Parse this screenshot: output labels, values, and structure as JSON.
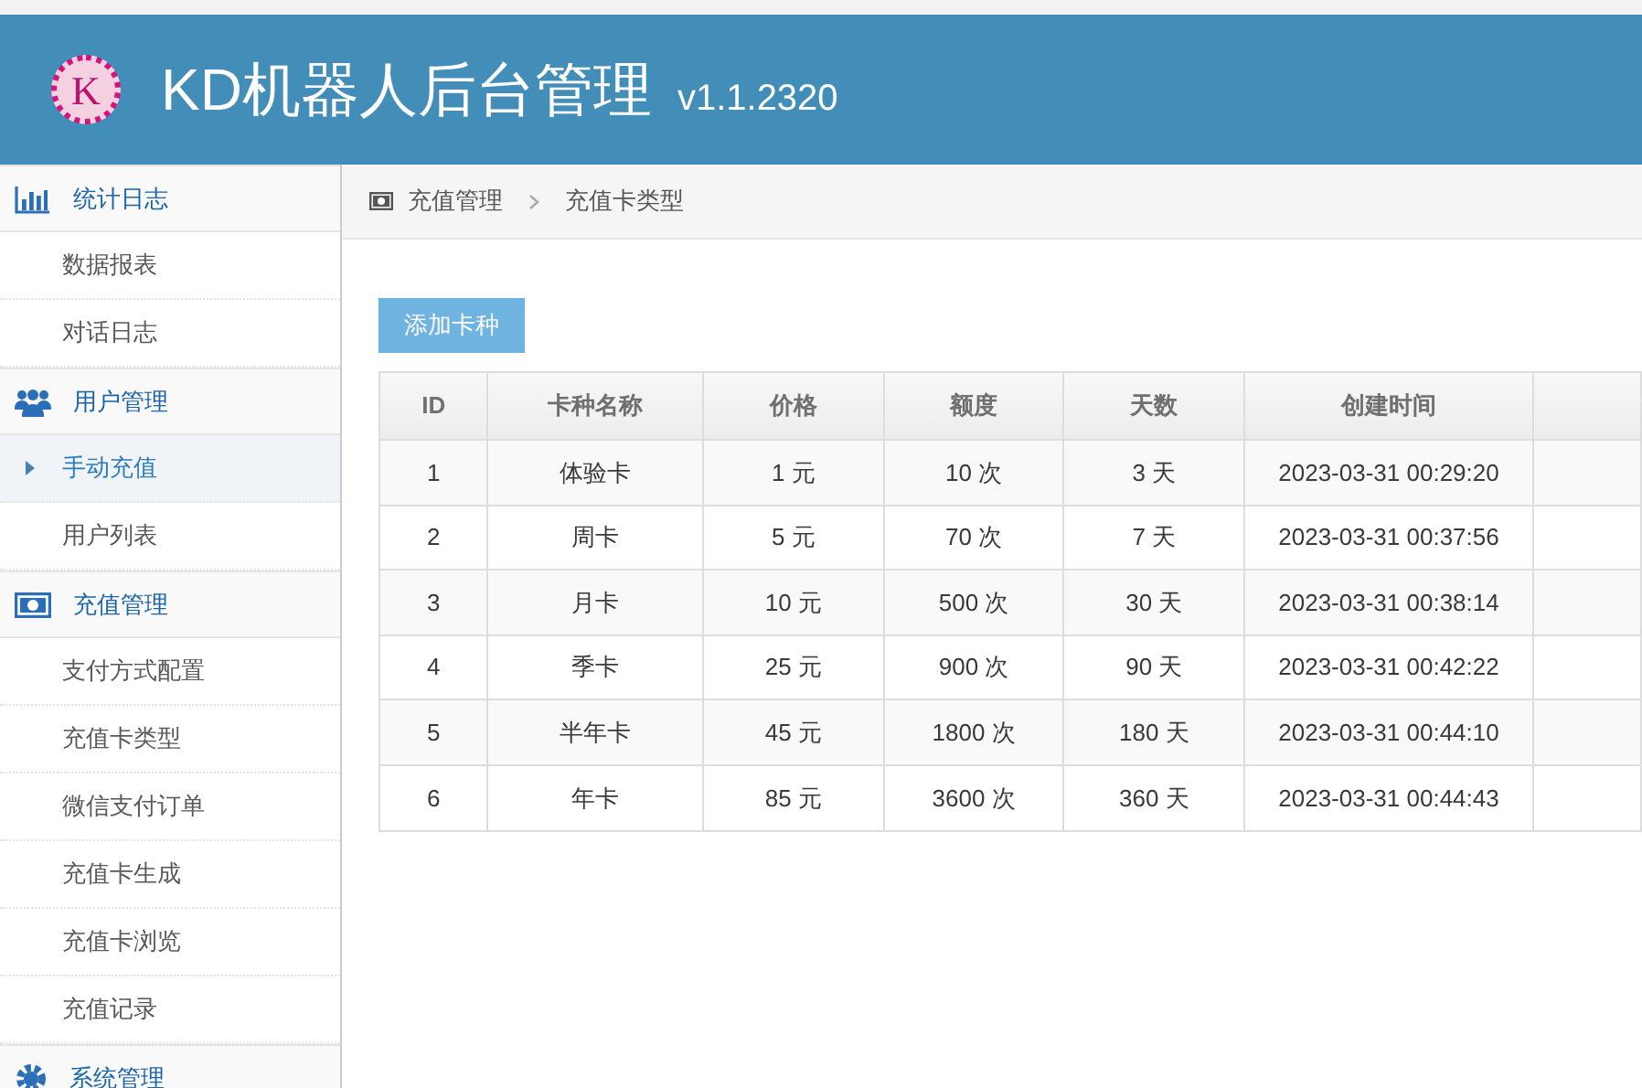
{
  "header": {
    "logo_letter": "K",
    "title": "KD机器人后台管理",
    "version": "v1.1.2320"
  },
  "sidebar": {
    "groups": [
      {
        "kind": "chart",
        "label": "统计日志",
        "items": [
          {
            "label": "数据报表",
            "selected": false
          },
          {
            "label": "对话日志",
            "selected": false
          }
        ]
      },
      {
        "kind": "users",
        "label": "用户管理",
        "items": [
          {
            "label": "手动充值",
            "selected": true
          },
          {
            "label": "用户列表",
            "selected": false
          }
        ]
      },
      {
        "kind": "money",
        "label": "充值管理",
        "items": [
          {
            "label": "支付方式配置",
            "selected": false
          },
          {
            "label": "充值卡类型",
            "selected": false
          },
          {
            "label": "微信支付订单",
            "selected": false
          },
          {
            "label": "充值卡生成",
            "selected": false
          },
          {
            "label": "充值卡浏览",
            "selected": false
          },
          {
            "label": "充值记录",
            "selected": false
          }
        ]
      },
      {
        "kind": "gear",
        "label": "系统管理"
      }
    ]
  },
  "breadcrumb": [
    "充值管理",
    "充值卡类型"
  ],
  "add_button": "添加卡种",
  "table": {
    "columns": [
      "ID",
      "卡种名称",
      "价格",
      "额度",
      "天数",
      "创建时间"
    ],
    "rows": [
      [
        "1",
        "体验卡",
        "1 元",
        "10 次",
        "3 天",
        "2023-03-31 00:29:20"
      ],
      [
        "2",
        "周卡",
        "5 元",
        "70 次",
        "7 天",
        "2023-03-31 00:37:56"
      ],
      [
        "3",
        "月卡",
        "10 元",
        "500 次",
        "30 天",
        "2023-03-31 00:38:14"
      ],
      [
        "4",
        "季卡",
        "25 元",
        "900 次",
        "90 天",
        "2023-03-31 00:42:22"
      ],
      [
        "5",
        "半年卡",
        "45 元",
        "1800 次",
        "180 天",
        "2023-03-31 00:44:10"
      ],
      [
        "6",
        "年卡",
        "85 元",
        "3600 次",
        "360 天",
        "2023-03-31 00:44:43"
      ]
    ]
  }
}
